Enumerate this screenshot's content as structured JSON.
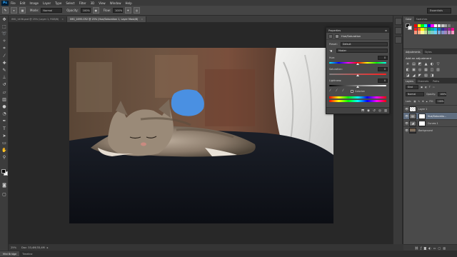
{
  "app": {
    "logo": "Ps"
  },
  "menu": [
    "File",
    "Edit",
    "Image",
    "Layer",
    "Type",
    "Select",
    "Filter",
    "3D",
    "View",
    "Window",
    "Help"
  ],
  "options_bar": {
    "tool_icon": "brush-icon",
    "mode_label": "Mode:",
    "mode_value": "Normal",
    "opacity_label": "Opacity:",
    "opacity_value": "100%",
    "flow_label": "Flow:",
    "flow_value": "100%",
    "workspace": "Essentials"
  },
  "document_tabs": [
    {
      "title": "IMG_1456.psd @ 25% (Layer 1, RGB/8)",
      "active": false
    },
    {
      "title": "IMG_1695.CR2 @ 25% (Hue/Saturation 1, Layer Mask/8)",
      "active": true
    }
  ],
  "status_bar": {
    "zoom": "25%",
    "doc": "Doc: 33,4M/33,4M"
  },
  "bottom_tabs": [
    {
      "label": "Mini Bridge",
      "active": true
    },
    {
      "label": "Timeline",
      "active": false
    }
  ],
  "properties_panel": {
    "tab": "Properties",
    "title": "Hue/Saturation",
    "preset_label": "Preset:",
    "preset_value": "Default",
    "channel_value": "Master",
    "hue_label": "Hue:",
    "hue_value": "0",
    "saturation_label": "Saturation:",
    "saturation_value": "0",
    "lightness_label": "Lightness:",
    "lightness_value": "0",
    "colorize_label": "Colorize"
  },
  "right_panels": {
    "color_tabs": [
      "Color",
      "Swatches"
    ],
    "swatch_colors": [
      "#ff0000",
      "#ffff00",
      "#00ff00",
      "#00ffff",
      "#0000ff",
      "#ff00ff",
      "#ffffff",
      "#e6e6e6",
      "#c8c8c8",
      "#a0a0a0",
      "#787878",
      "#505050",
      "#ed1c24",
      "#f26522",
      "#fff200",
      "#8dc63f",
      "#00a651",
      "#00a99d",
      "#00aeef",
      "#0072bc",
      "#2e3192",
      "#662d91",
      "#92278f",
      "#ec008c",
      "#f7977a",
      "#fbad82",
      "#fff79a",
      "#c4df9b",
      "#82ca9c",
      "#7accc8",
      "#6dcff6",
      "#7da7d9",
      "#8393ca",
      "#a187be",
      "#bc8dbf",
      "#f49ac2"
    ],
    "adjust_tabs": [
      "Adjustments",
      "Styles"
    ],
    "adjust_title": "Add an adjustment",
    "adjust_icons_row1": [
      "☀",
      "▤",
      "◩",
      "▲",
      "◐",
      "▽"
    ],
    "adjust_icons_row2": [
      "◧",
      "▣",
      "◎",
      "▦",
      "◫",
      "▥"
    ],
    "adjust_icons_row3": [
      "◪",
      "◢",
      "◤",
      "▧",
      "◨"
    ],
    "layers_tabs": [
      "Layers",
      "Channels",
      "Paths"
    ],
    "kind_label": "Kind",
    "blend_mode": "Normal",
    "opacity_label": "Opacity:",
    "opacity_value": "100%",
    "lock_label": "Lock:",
    "fill_label": "Fill:",
    "fill_value": "100%",
    "layers": [
      {
        "name": "Layer 1",
        "type": "pixel",
        "selected": false
      },
      {
        "name": "Hue/Saturatio...",
        "type": "adjustment",
        "selected": true
      },
      {
        "name": "Curves 1",
        "type": "adjustment",
        "selected": false
      },
      {
        "name": "Background",
        "type": "photo",
        "selected": false
      }
    ]
  }
}
